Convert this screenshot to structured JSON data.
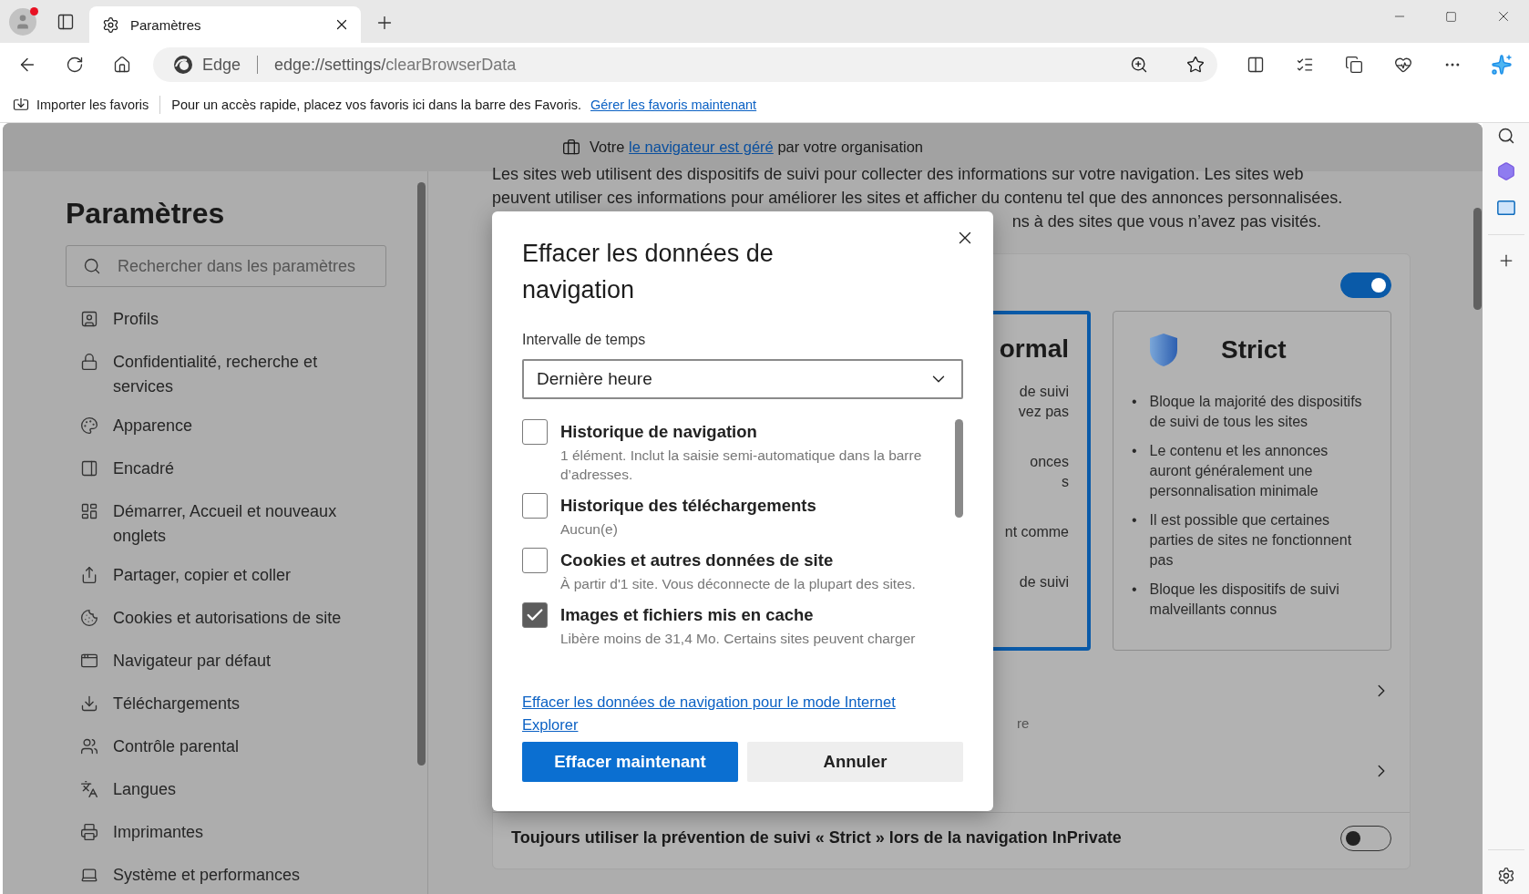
{
  "tabs": [
    {
      "title": "Paramètres",
      "selected": true
    }
  ],
  "address_bar": {
    "site_label": "Edge",
    "url_main": "edge://settings/",
    "url_path": "clearBrowserData"
  },
  "favorites_bar": {
    "import": "Importer les favoris",
    "hint": "Pour un accès rapide, placez vos favoris ici dans la barre des Favoris.",
    "link": "Gérer les favoris maintenant"
  },
  "managed_banner": {
    "before": "Votre",
    "link": "le navigateur est géré",
    "after": "par votre organisation"
  },
  "sidebar": {
    "title": "Paramètres",
    "search_placeholder": "Rechercher dans les paramètres",
    "items": [
      {
        "label": "Profils"
      },
      {
        "label": "Confidentialité, recherche et services"
      },
      {
        "label": "Apparence"
      },
      {
        "label": "Encadré"
      },
      {
        "label": "Démarrer, Accueil et nouveaux onglets"
      },
      {
        "label": "Partager, copier et coller"
      },
      {
        "label": "Cookies et autorisations de site"
      },
      {
        "label": "Navigateur par défaut"
      },
      {
        "label": "Téléchargements"
      },
      {
        "label": "Contrôle parental"
      },
      {
        "label": "Langues"
      },
      {
        "label": "Imprimantes"
      },
      {
        "label": "Système et performances"
      }
    ]
  },
  "content": {
    "intro_lines": [
      "Les sites web utilisent des dispositifs de suivi pour collecter des informations sur votre navigation. Les sites web",
      "peuvent utiliser ces informations pour améliorer les sites et afficher du contenu tel que des annonces personnalisées.",
      "ns à des sites que vous n’avez pas visités."
    ],
    "tracking_on": true,
    "normal_card": {
      "title": "ormal",
      "selected": true,
      "groups": [
        [
          "de suivi",
          "vez pas"
        ],
        [
          "onces",
          "s"
        ],
        [
          "nt comme"
        ],
        [
          "de suivi"
        ]
      ]
    },
    "strict_card": {
      "title": "Strict",
      "selected": false,
      "bullets": [
        {
          "marker": "•",
          "text": "Bloque la majorité des dispositifs de suivi de tous les sites"
        },
        {
          "marker": "•",
          "text": "Le contenu et les annonces auront généralement une personnalisation minimale"
        },
        {
          "marker": "•",
          "text": "Il est possible que certaines parties de sites ne fonctionnent pas"
        },
        {
          "marker": "•",
          "text": "Bloque les dispositifs de suivi malveillants connus"
        }
      ]
    },
    "link_rows": [
      {
        "fragment": "re"
      },
      {}
    ],
    "inprivate": {
      "label": "Toujours utiliser la prévention de suivi « Strict » lors de la navigation InPrivate",
      "on": false
    }
  },
  "dialog": {
    "title": "Effacer les données de navigation",
    "range_label": "Intervalle de temps",
    "range_value": "Dernière heure",
    "items": [
      {
        "label": "Historique de navigation",
        "detail": "1 élément. Inclut la saisie semi-automatique dans la barre d’adresses.",
        "checked": false
      },
      {
        "label": "Historique des téléchargements",
        "detail": "Aucun(e)",
        "checked": false
      },
      {
        "label": "Cookies et autres données de site",
        "detail": "À partir d'1 site. Vous déconnecte de la plupart des sites.",
        "checked": false
      },
      {
        "label": "Images et fichiers mis en cache",
        "detail": "Libère moins de 31,4 Mo. Certains sites peuvent charger",
        "checked": true
      }
    ],
    "link": "Effacer les données de navigation pour le mode Internet Explorer",
    "primary": "Effacer maintenant",
    "cancel": "Annuler"
  }
}
